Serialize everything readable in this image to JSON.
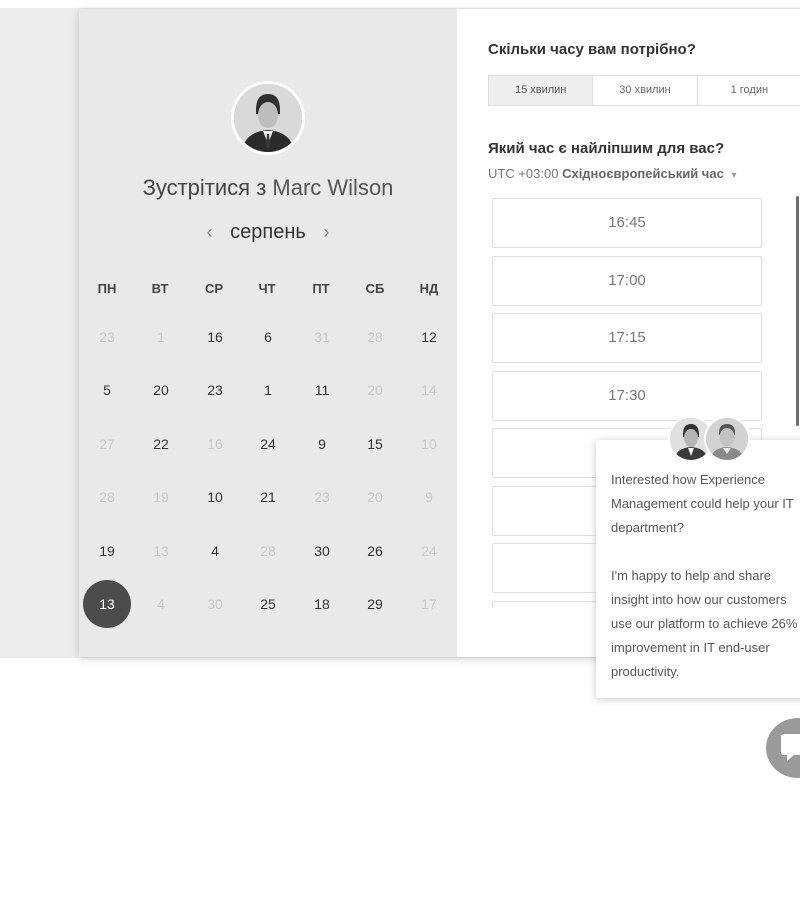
{
  "host": {
    "title_prefix": "Зустрітися з",
    "name": "Marc Wilson"
  },
  "calendar": {
    "month": "серпень",
    "prev_icon": "‹",
    "next_icon": "›",
    "weekdays": [
      "ПН",
      "ВТ",
      "СР",
      "ЧТ",
      "ПТ",
      "СБ",
      "НД"
    ],
    "weeks": [
      [
        {
          "d": "23",
          "muted": true
        },
        {
          "d": "1",
          "muted": true
        },
        {
          "d": "16"
        },
        {
          "d": "6"
        },
        {
          "d": "31",
          "muted": true
        },
        {
          "d": "28",
          "muted": true
        },
        {
          "d": "12"
        }
      ],
      [
        {
          "d": "5"
        },
        {
          "d": "20"
        },
        {
          "d": "23"
        },
        {
          "d": "1"
        },
        {
          "d": "11"
        },
        {
          "d": "20",
          "muted": true
        },
        {
          "d": "14",
          "muted": true
        }
      ],
      [
        {
          "d": "27",
          "muted": true
        },
        {
          "d": "22"
        },
        {
          "d": "16",
          "muted": true
        },
        {
          "d": "24"
        },
        {
          "d": "9"
        },
        {
          "d": "15"
        },
        {
          "d": "10",
          "muted": true
        }
      ],
      [
        {
          "d": "28",
          "muted": true
        },
        {
          "d": "19",
          "muted": true
        },
        {
          "d": "10"
        },
        {
          "d": "21"
        },
        {
          "d": "23",
          "muted": true
        },
        {
          "d": "20",
          "muted": true
        },
        {
          "d": "9",
          "muted": true
        }
      ],
      [
        {
          "d": "19"
        },
        {
          "d": "13",
          "muted": true
        },
        {
          "d": "4"
        },
        {
          "d": "28",
          "muted": true
        },
        {
          "d": "30"
        },
        {
          "d": "26"
        },
        {
          "d": "24",
          "muted": true
        }
      ],
      [
        {
          "d": "13",
          "selected": true
        },
        {
          "d": "4",
          "muted": true
        },
        {
          "d": "30",
          "muted": true
        },
        {
          "d": "25"
        },
        {
          "d": "18"
        },
        {
          "d": "29"
        },
        {
          "d": "17",
          "muted": true
        }
      ]
    ]
  },
  "booking": {
    "duration_question": "Скільки часу вам потрібно?",
    "durations": [
      "15 хвилин",
      "30 хвилин",
      "1 годин"
    ],
    "active_duration": 0,
    "time_question": "Який час є найліпшим для вас?",
    "timezone_offset": "UTC +03:00",
    "timezone_name": "Східноєвропейський час",
    "timezone_caret": "▾",
    "slots": [
      "16:45",
      "17:00",
      "17:15",
      "17:30",
      "",
      "",
      "",
      ""
    ]
  },
  "chat_popup": {
    "message_1": "Interested how Experience Management could help your IT department?",
    "message_2": "I'm happy to help and share insight into how our customers use our platform to achieve 26% improvement in IT end-user productivity."
  },
  "icons": {
    "avatar": "avatar-icon",
    "chat": "chat-bubble-icon"
  },
  "colors": {
    "selected_day": "#4c4c4c",
    "left_panel": "#e9e9e9",
    "chat_button": "#9a9a9a"
  }
}
